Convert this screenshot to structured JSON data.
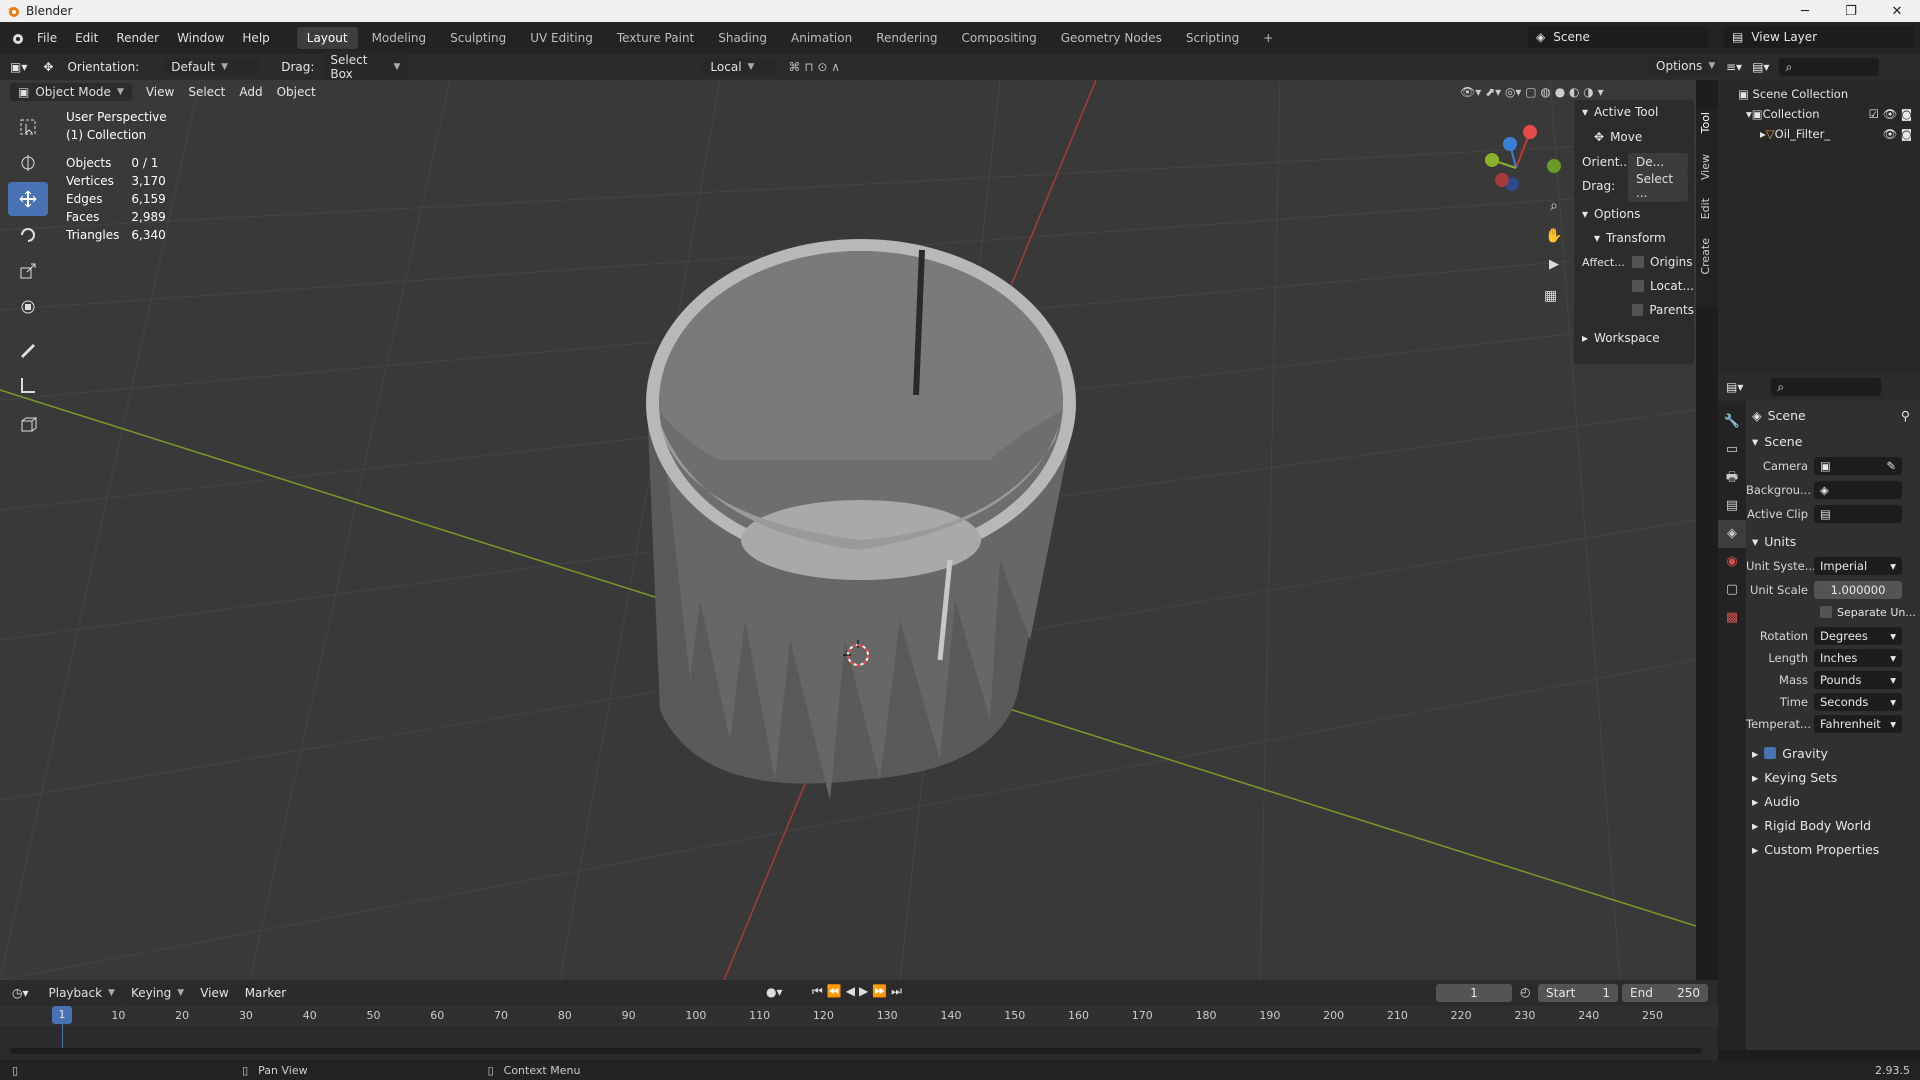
{
  "window": {
    "title": "Blender",
    "minimize": "─",
    "restore": "❐",
    "close": "✕"
  },
  "menu": {
    "items": [
      "File",
      "Edit",
      "Render",
      "Window",
      "Help"
    ]
  },
  "workspaces": [
    "Layout",
    "Modeling",
    "Sculpting",
    "UV Editing",
    "Texture Paint",
    "Shading",
    "Animation",
    "Rendering",
    "Compositing",
    "Geometry Nodes",
    "Scripting"
  ],
  "scene_name": "Scene",
  "view_layer": "View Layer",
  "header": {
    "orientation_label": "Orientation:",
    "orientation_value": "Default",
    "drag_label": "Drag:",
    "drag_value": "Select Box",
    "pivot": "Local",
    "options": "Options"
  },
  "viewport_header": {
    "mode": "Object Mode",
    "menus": [
      "View",
      "Select",
      "Add",
      "Object"
    ]
  },
  "viewport": {
    "title": "User Perspective",
    "collection": "(1) Collection"
  },
  "stats": [
    {
      "k": "Objects",
      "v": "0 / 1"
    },
    {
      "k": "Vertices",
      "v": "3,170"
    },
    {
      "k": "Edges",
      "v": "6,159"
    },
    {
      "k": "Faces",
      "v": "2,989"
    },
    {
      "k": "Triangles",
      "v": "6,340"
    }
  ],
  "npanel": {
    "active_tool": "Active Tool",
    "tool": "Move",
    "orient_label": "Orient...",
    "orient_value": "De...",
    "drag_label": "Drag:",
    "drag_value": "Select ...",
    "options": "Options",
    "transform": "Transform",
    "affect": "Affect...",
    "origins": "Origins",
    "locations": "Locat...",
    "parents": "Parents",
    "workspace": "Workspace"
  },
  "npanel_tabs": [
    "Tool",
    "View",
    "Edit",
    "Create"
  ],
  "outliner": {
    "root": "Scene Collection",
    "collection": "Collection",
    "object": "Oil_Filter_"
  },
  "properties": {
    "scene_header": "Scene",
    "scene_section": "Scene",
    "camera": "Camera",
    "background": "Backgrou...",
    "active_clip": "Active Clip",
    "units": "Units",
    "rows": [
      {
        "k": "Unit Syste...",
        "v": "Imperial"
      },
      {
        "k": "Unit Scale",
        "v": "1.000000"
      },
      {
        "k": "Rotation",
        "v": "Degrees"
      },
      {
        "k": "Length",
        "v": "Inches"
      },
      {
        "k": "Mass",
        "v": "Pounds"
      },
      {
        "k": "Time",
        "v": "Seconds"
      },
      {
        "k": "Temperat...",
        "v": "Fahrenheit"
      }
    ],
    "separate_units": "Separate Un...",
    "sections": [
      "Gravity",
      "Keying Sets",
      "Audio",
      "Rigid Body World",
      "Custom Properties"
    ]
  },
  "timeline": {
    "menus": [
      "Playback",
      "Keying",
      "View",
      "Marker"
    ],
    "current_frame": "1",
    "start_label": "Start",
    "start": "1",
    "end_label": "End",
    "end": "250",
    "ticks": [
      "1",
      "10",
      "20",
      "30",
      "40",
      "50",
      "60",
      "70",
      "80",
      "90",
      "100",
      "110",
      "120",
      "130",
      "140",
      "150",
      "160",
      "170",
      "180",
      "190",
      "200",
      "210",
      "220",
      "230",
      "240",
      "250"
    ]
  },
  "status": {
    "pan": "Pan View",
    "context": "Context Menu",
    "version": "2.93.5"
  },
  "colors": {
    "accent": "#4772b3",
    "x_axis": "#c0392b",
    "y_axis": "#8bb02a",
    "viewport_bg": "#393939"
  }
}
